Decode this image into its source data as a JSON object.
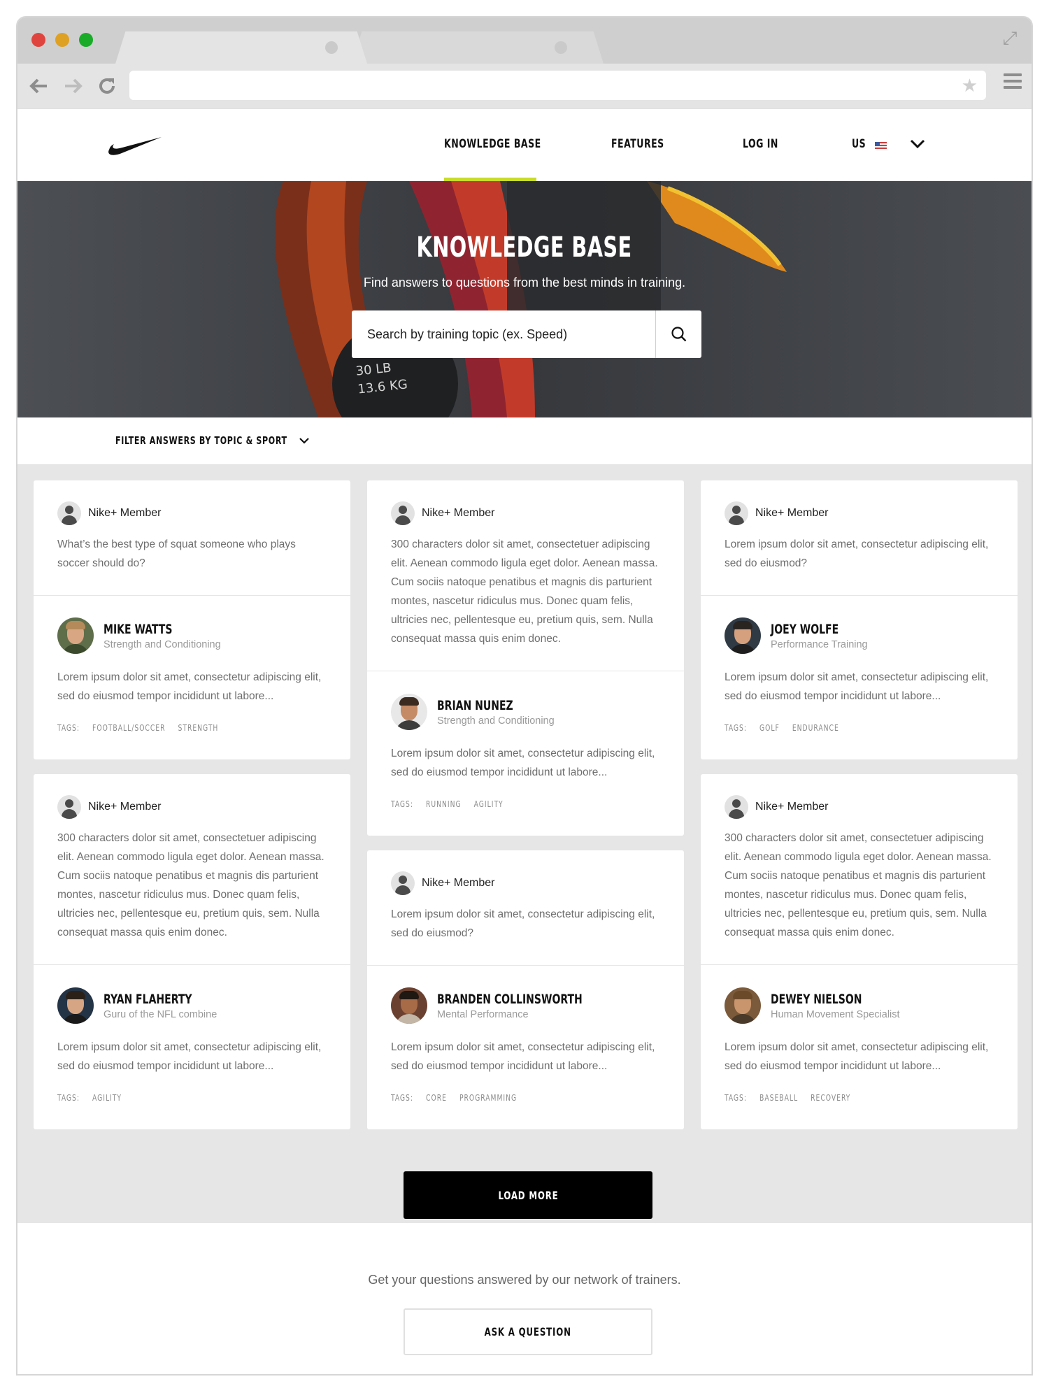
{
  "brand": {
    "accent": "#c8dc2b"
  },
  "nav": {
    "items": [
      "KNOWLEDGE BASE",
      "FEATURES",
      "LOG IN"
    ],
    "locale": "US"
  },
  "hero": {
    "title": "KNOWLEDGE BASE",
    "subtitle": "Find answers to questions from the best minds in training.",
    "search_placeholder": "Search by training topic (ex. Speed)",
    "weight_line1": "30 LB",
    "weight_line2": "13.6 KG"
  },
  "filter": {
    "label": "FILTER ANSWERS BY TOPIC & SPORT"
  },
  "cards": [
    {
      "member": "Nike+ Member",
      "question": "What’s the best type of squat someone who plays soccer should do?",
      "trainer": "MIKE WATTS",
      "role": "Strength and Conditioning",
      "answer": "Lorem ipsum dolor sit amet, consectetur adipiscing elit, sed do eiusmod tempor incididunt ut labore...",
      "tags_label": "TAGS:",
      "tags": [
        "FOOTBALL/SOCCER",
        "STRENGTH"
      ]
    },
    {
      "member": "Nike+ Member",
      "question": "300 characters dolor sit amet, consectetuer adipiscing elit. Aenean commodo ligula eget dolor. Aenean massa. Cum sociis natoque penatibus et magnis dis parturient montes, nascetur ridiculus mus. Donec quam felis, ultricies nec, pellentesque eu, pretium quis, sem. Nulla consequat massa quis enim donec.",
      "trainer": "BRIAN NUNEZ",
      "role": "Strength and Conditioning",
      "answer": "Lorem ipsum dolor sit amet, consectetur adipiscing elit, sed do eiusmod tempor incididunt ut labore...",
      "tags_label": "TAGS:",
      "tags": [
        "RUNNING",
        "AGILITY"
      ]
    },
    {
      "member": "Nike+ Member",
      "question": "Lorem ipsum dolor sit amet, consectetur adipiscing elit, sed do eiusmod?",
      "trainer": "JOEY WOLFE",
      "role": "Performance Training",
      "answer": "Lorem ipsum dolor sit amet, consectetur adipiscing elit, sed do eiusmod tempor incididunt ut labore...",
      "tags_label": "TAGS:",
      "tags": [
        "GOLF",
        "ENDURANCE"
      ]
    },
    {
      "member": "Nike+ Member",
      "question": "300 characters dolor sit amet, consectetuer adipiscing elit. Aenean commodo ligula eget dolor. Aenean massa. Cum sociis natoque penatibus et magnis dis parturient montes, nascetur ridiculus mus. Donec quam felis, ultricies nec, pellentesque eu, pretium quis, sem. Nulla consequat massa quis enim donec.",
      "trainer": "RYAN FLAHERTY",
      "role": "Guru of the NFL combine",
      "answer": "Lorem ipsum dolor sit amet, consectetur adipiscing elit, sed do eiusmod tempor incididunt ut labore...",
      "tags_label": "TAGS:",
      "tags": [
        "AGILITY"
      ]
    },
    {
      "member": "Nike+ Member",
      "question": "Lorem ipsum dolor sit amet, consectetur adipiscing elit, sed do eiusmod?",
      "trainer": "BRANDEN COLLINSWORTH",
      "role": "Mental Performance",
      "answer": "Lorem ipsum dolor sit amet, consectetur adipiscing elit, sed do eiusmod tempor incididunt ut labore...",
      "tags_label": "TAGS:",
      "tags": [
        "CORE",
        "PROGRAMMING"
      ]
    },
    {
      "member": "Nike+ Member",
      "question": "300 characters dolor sit amet, consectetuer adipiscing elit. Aenean commodo ligula eget dolor. Aenean massa. Cum sociis natoque penatibus et magnis dis parturient montes, nascetur ridiculus mus. Donec quam felis, ultricies nec, pellentesque eu, pretium quis, sem. Nulla consequat massa quis enim donec.",
      "trainer": "DEWEY NIELSON",
      "role": "Human Movement Specialist",
      "answer": "Lorem ipsum dolor sit amet, consectetur adipiscing elit, sed do eiusmod tempor incididunt ut labore...",
      "tags_label": "TAGS:",
      "tags": [
        "BASEBALL",
        "RECOVERY"
      ]
    }
  ],
  "load_more": "LOAD MORE",
  "footer": {
    "text": "Get your questions answered by our network of trainers.",
    "ask_button": "ASK A QUESTION"
  }
}
